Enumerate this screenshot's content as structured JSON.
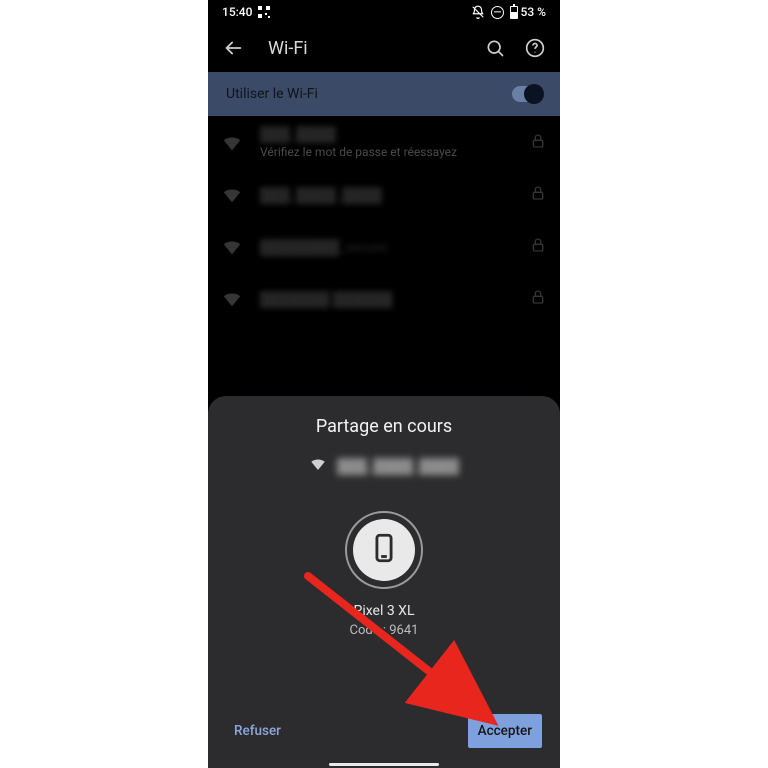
{
  "statusbar": {
    "time": "15:40",
    "battery_text": "53 %"
  },
  "appbar": {
    "title": "Wi-Fi"
  },
  "wifi_toggle": {
    "label": "Utiliser le Wi-Fi"
  },
  "networks": [
    {
      "ssid": "███_████",
      "sub": "Vérifiez le mot de passe et réessayez",
      "locked": true
    },
    {
      "ssid": "███_████_████",
      "sub": "",
      "locked": true
    },
    {
      "ssid": "████████_secure",
      "sub": "",
      "locked": true
    },
    {
      "ssid": "███████ ██████",
      "sub": "",
      "locked": true
    }
  ],
  "sheet": {
    "title": "Partage en cours",
    "shared_ssid": "███_████_████",
    "device_name": "Pixel 3 XL",
    "code_label": "Code : 9641",
    "refuse": "Refuser",
    "accept": "Accepter"
  },
  "colors": {
    "highlight_arrow": "#e8261d"
  }
}
